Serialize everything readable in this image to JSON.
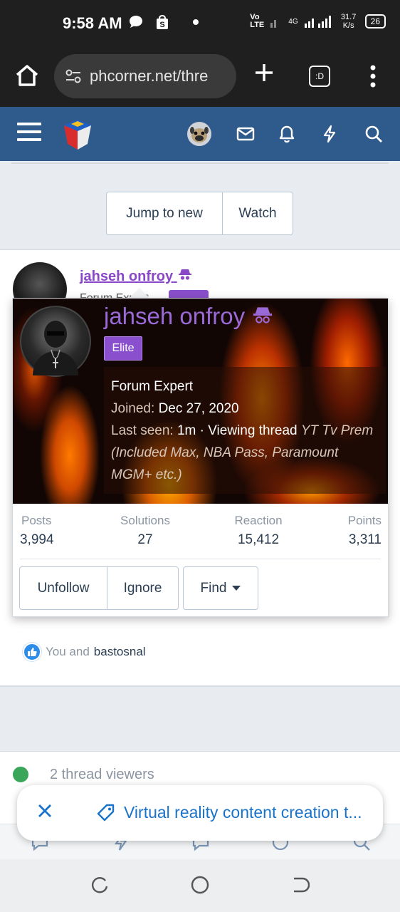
{
  "status_bar": {
    "time": "9:58 AM",
    "network_label": "Vo LTE",
    "signal_label": "4G",
    "speed": "31.7 K/s",
    "battery": "26"
  },
  "browser": {
    "url": "phcorner.net/thre",
    "tabs_label": ":D"
  },
  "thread_buttons": {
    "jump_to_new": "Jump to new",
    "watch": "Watch"
  },
  "post": {
    "username": "jahseh onfroy",
    "subtitle": "Forum Expert",
    "reactions": {
      "prefix": "You and",
      "user": "bastosnal"
    }
  },
  "member_card": {
    "name": "jahseh onfroy",
    "badge": "Elite",
    "title": "Forum Expert",
    "joined_label": "Joined:",
    "joined_value": "Dec 27, 2020",
    "last_seen_label": "Last seen:",
    "last_seen_value": "1m · Viewing thread",
    "last_seen_thread": "YT Tv Prem (Included Max, NBA Pass, Paramount MGM+ etc.)",
    "stats": [
      {
        "label": "Posts",
        "value": "3,994"
      },
      {
        "label": "Solutions",
        "value": "27"
      },
      {
        "label": "Reaction",
        "value": "15,412"
      },
      {
        "label": "Points",
        "value": "3,311"
      }
    ],
    "buttons": {
      "unfollow": "Unfollow",
      "ignore": "Ignore",
      "find": "Find"
    }
  },
  "viewers": {
    "label": "2 thread viewers"
  },
  "toast": {
    "title": "Virtual reality content creation t..."
  },
  "colors": {
    "header_blue": "#2e5a8c",
    "username_purple": "#8a48c9",
    "badge_purple": "#8a4fcc",
    "link_blue": "#1a73c9"
  }
}
